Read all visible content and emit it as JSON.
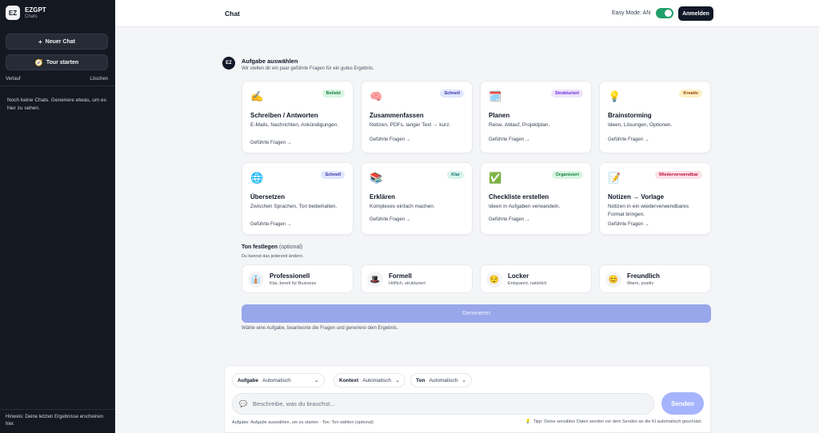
{
  "sidebar": {
    "brand_logo": "EZ",
    "brand_name": "EZGPT",
    "brand_sub": "Chats",
    "new_chat": "Neuer Chat",
    "tour": "Tour starten",
    "history_label": "Verlauf",
    "clear_label": "Löschen",
    "empty_text": "Noch keine Chats. Generiere etwas, um es hier zu sehen.",
    "hint": "Hinweis: Deine letzten Ergebnisse erscheinen hier."
  },
  "header": {
    "title": "Chat",
    "easy_mode": "Easy Mode: AN",
    "easy_mode_on": true,
    "login": "Anmelden"
  },
  "task": {
    "avatar": "EZ",
    "title": "Aufgabe auswählen",
    "subtitle": "Wir stellen dir ein paar geführte Fragen für ein gutes Ergebnis.",
    "cards": [
      {
        "emoji": "✍️",
        "icon": "writing-hand-icon",
        "badge": "Beliebt",
        "badge_bg": "#d9f5e3",
        "badge_fg": "#15803d",
        "title": "Schreiben / Antworten",
        "desc": "E-Mails, Nachrichten, Ankündigungen.",
        "link": "Geführte Fragen →"
      },
      {
        "emoji": "🧠",
        "icon": "brain-icon",
        "badge": "Schnell",
        "badge_bg": "#e0e7ff",
        "badge_fg": "#3730a3",
        "title": "Zusammenfassen",
        "desc": "Notizen, PDFs, langer Text → kurz.",
        "link": "Geführte Fragen →"
      },
      {
        "emoji": "🗓️",
        "icon": "calendar-icon",
        "badge": "Strukturiert",
        "badge_bg": "#ede4fb",
        "badge_fg": "#6d28d9",
        "title": "Planen",
        "desc": "Reise, Ablauf, Projektplan.",
        "link": "Geführte Fragen →"
      },
      {
        "emoji": "💡",
        "icon": "light-bulb-icon",
        "badge": "Kreativ",
        "badge_bg": "#fdf0c4",
        "badge_fg": "#92400e",
        "title": "Brainstorming",
        "desc": "Ideen, Lösungen, Optionen.",
        "link": "Geführte Fragen →"
      },
      {
        "emoji": "🌐",
        "icon": "globe-icon",
        "badge": "Schnell",
        "badge_bg": "#e0e7ff",
        "badge_fg": "#3730a3",
        "title": "Übersetzen",
        "desc": "Zwischen Sprachen, Ton beibehalten.",
        "link": "Geführte Fragen →"
      },
      {
        "emoji": "📚",
        "icon": "books-icon",
        "badge": "Klar",
        "badge_bg": "#d7f3ec",
        "badge_fg": "#0f766e",
        "title": "Erklären",
        "desc": "Komplexes einfach machen.",
        "link": "Geführte Fragen →"
      },
      {
        "emoji": "✅",
        "icon": "check-mark-icon",
        "badge": "Organisiert",
        "badge_bg": "#d9f5e3",
        "badge_fg": "#15803d",
        "title": "Checkliste erstellen",
        "desc": "Ideen in Aufgaben verwandeln.",
        "link": "Geführte Fragen →"
      },
      {
        "emoji": "📝",
        "icon": "memo-icon",
        "badge": "Wiederverwendbar",
        "badge_bg": "#fde2e8",
        "badge_fg": "#be123c",
        "title": "Notizen → Vorlage",
        "desc": "Notizen in ein wiederverwendbares Format bringen.",
        "link": "Geführte Fragen →"
      }
    ]
  },
  "tone": {
    "title": "Ton festlegen",
    "optional": "(optional)",
    "subtitle": "Du kannst das jederzeit ändern.",
    "options": [
      {
        "emoji": "👔",
        "icon": "professional-icon",
        "name": "Professionell",
        "desc": "Klar, bereit für Business"
      },
      {
        "emoji": "🎩",
        "icon": "top-hat-icon",
        "name": "Formell",
        "desc": "Höflich, strukturiert"
      },
      {
        "emoji": "😌",
        "icon": "relaxed-face-icon",
        "name": "Locker",
        "desc": "Entspannt, natürlich"
      },
      {
        "emoji": "😊",
        "icon": "smiling-face-icon",
        "name": "Freundlich",
        "desc": "Warm, positiv"
      }
    ]
  },
  "generate": {
    "label": "Generieren",
    "hint": "Wähle eine Aufgabe, beantworte die Fragen und generiere dein Ergebnis."
  },
  "composer": {
    "task_label": "Aufgabe",
    "task_value": "Automatisch",
    "context_label": "Kontext",
    "context_value": "Automatisch",
    "tone_label": "Ton",
    "tone_value": "Automatisch",
    "placeholder": "Beschreibe, was du brauchst...",
    "send": "Senden",
    "hint": "Aufgabe: Aufgabe auswählen, um zu starten · Ton: Ton wählen (optional)",
    "tip": "Tipp: Deine sensiblen Daten werden vor dem Senden an die KI automatisch geschützt."
  }
}
